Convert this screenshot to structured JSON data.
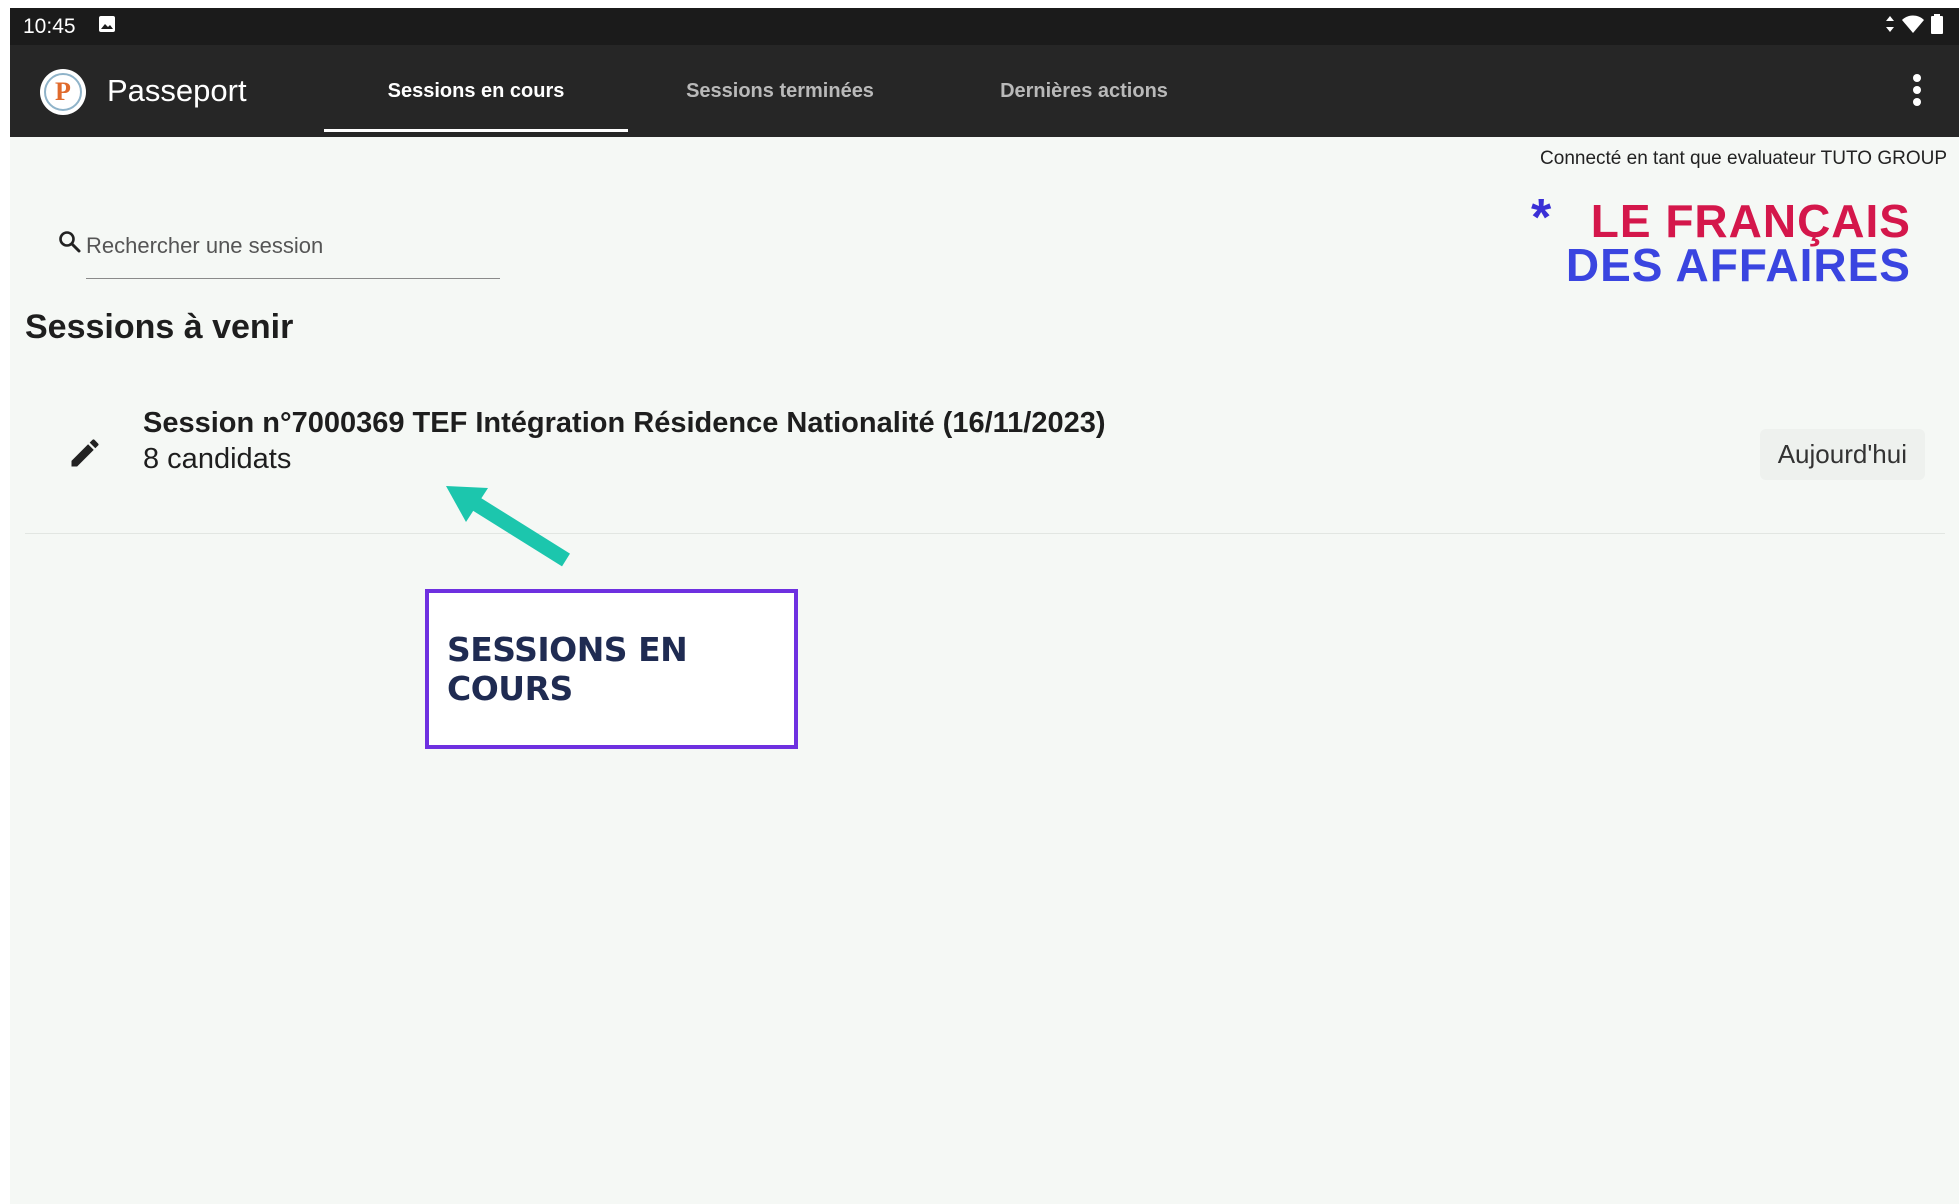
{
  "status_bar": {
    "time": "10:45",
    "icons": [
      "image-icon",
      "data-arrows-icon",
      "wifi-icon",
      "battery-icon"
    ]
  },
  "app_bar": {
    "title": "Passeport",
    "logo_letter": "P",
    "tabs": [
      {
        "label": "Sessions en cours",
        "active": true
      },
      {
        "label": "Sessions terminées",
        "active": false
      },
      {
        "label": "Dernières actions",
        "active": false
      }
    ],
    "menu_icon": "more-vert-icon"
  },
  "header": {
    "connected_as": "Connecté en tant que evaluateur TUTO GROUP",
    "brand": {
      "line1": "LE FRANÇAIS",
      "line2": "DES AFFAIRES",
      "star": "*",
      "color_line1": "#d4174b",
      "color_line2": "#3a45e0"
    }
  },
  "search": {
    "placeholder": "Rechercher une session",
    "value": ""
  },
  "main": {
    "section_title": "Sessions à venir",
    "sessions": [
      {
        "title": "Session n°7000369 TEF Intégration Résidence Nationalité (16/11/2023)",
        "candidates": "8 candidats",
        "date_label": "Aujourd'hui"
      }
    ]
  },
  "annotation": {
    "label": "SESSIONS EN COURS",
    "arrow_color": "#1cc6ad",
    "box_color": "#6e30e0"
  },
  "colors": {
    "status_bar": "#1b1b1b",
    "app_bar": "#262626",
    "background": "#f5f8f5"
  }
}
